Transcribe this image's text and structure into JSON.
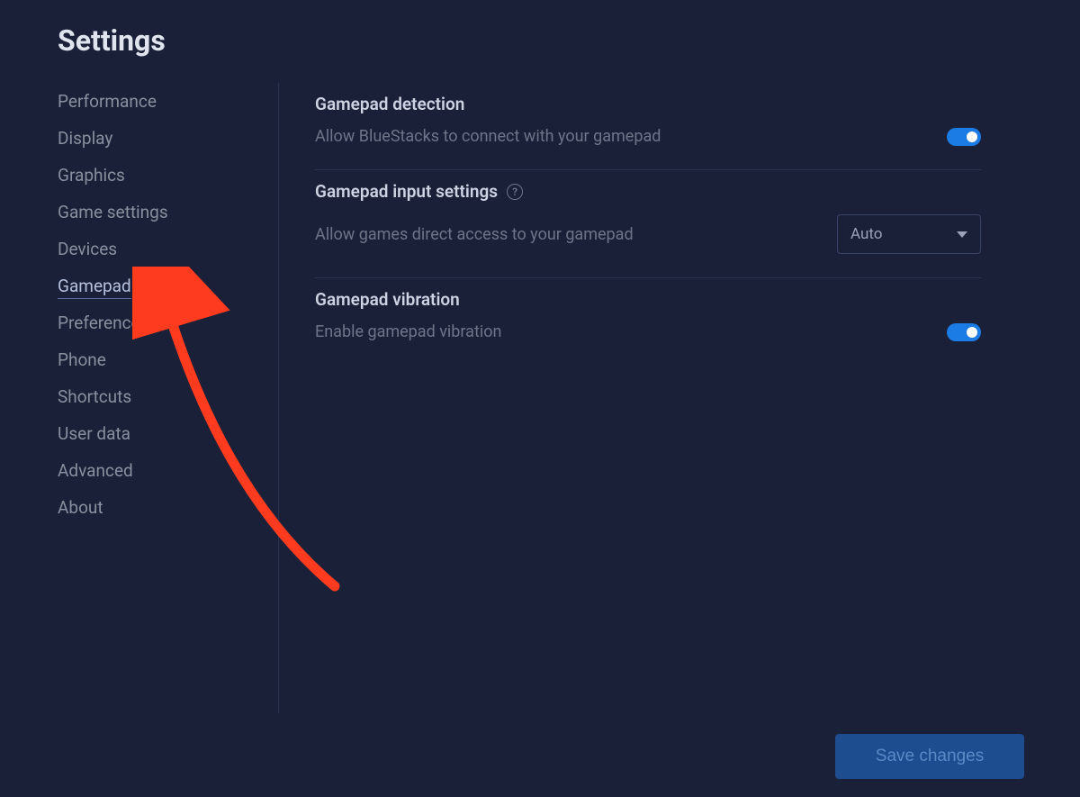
{
  "header": {
    "title": "Settings"
  },
  "sidebar": {
    "items": [
      {
        "label": "Performance",
        "active": false
      },
      {
        "label": "Display",
        "active": false
      },
      {
        "label": "Graphics",
        "active": false
      },
      {
        "label": "Game settings",
        "active": false
      },
      {
        "label": "Devices",
        "active": false
      },
      {
        "label": "Gamepad",
        "active": true
      },
      {
        "label": "Preferences",
        "active": false
      },
      {
        "label": "Phone",
        "active": false
      },
      {
        "label": "Shortcuts",
        "active": false
      },
      {
        "label": "User data",
        "active": false
      },
      {
        "label": "Advanced",
        "active": false
      },
      {
        "label": "About",
        "active": false
      }
    ]
  },
  "main": {
    "sections": [
      {
        "title": "Gamepad detection",
        "desc": "Allow BlueStacks to connect with your gamepad",
        "control_type": "toggle",
        "toggle_on": true
      },
      {
        "title": "Gamepad input settings",
        "has_help": true,
        "desc": "Allow games direct access to your gamepad",
        "control_type": "select",
        "select_value": "Auto"
      },
      {
        "title": "Gamepad vibration",
        "desc": "Enable gamepad vibration",
        "control_type": "toggle",
        "toggle_on": true
      }
    ]
  },
  "footer": {
    "save_label": "Save changes"
  },
  "annotation": {
    "arrow_color": "#ff3b1f"
  }
}
